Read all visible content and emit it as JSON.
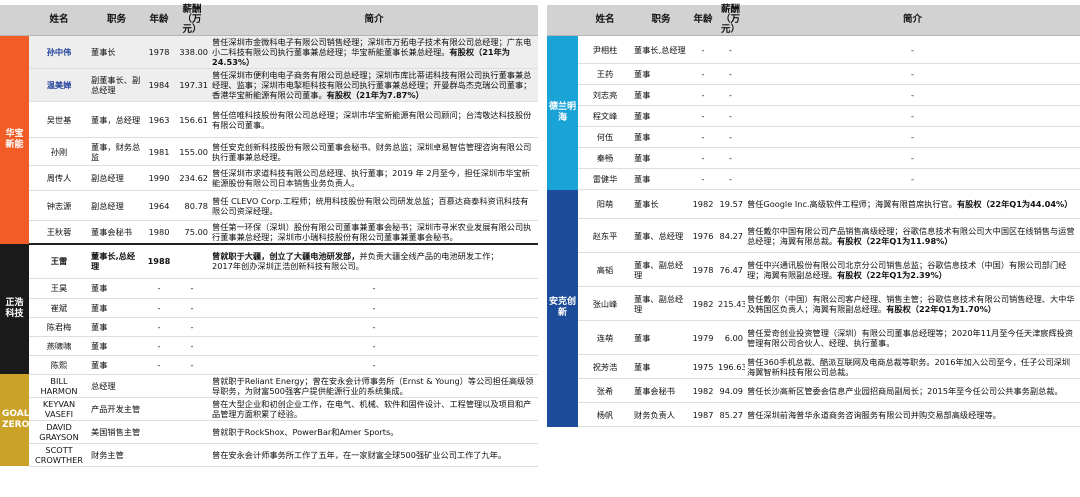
{
  "headers": {
    "company": "",
    "name": "姓名",
    "position": "职务",
    "age": "年龄",
    "salary": "薪酬（万元）",
    "bio": "简介"
  },
  "left_groups": [
    {
      "company": "华宝新能",
      "color": "#f25c27",
      "rows": [
        {
          "name": "孙中伟",
          "position": "董事长",
          "age": "1978",
          "salary": "338.00",
          "bio": "曾任深圳市金微科电子有限公司销售经理；深圳市万拓电子技术有限公司总经理；广东电小二科技有限公司执行董事兼总经理；华宝新能董事长兼总经理。",
          "bio_bold": "有股权（21年为24.53%）",
          "highlight": true
        },
        {
          "name": "温美婵",
          "position": "副董事长、副总经理",
          "age": "1984",
          "salary": "197.31",
          "bio": "曾任深圳市便利电电子商务有限公司总经理；深圳市库比蒂诺科技有限公司执行董事兼总经理、监事；深圳市电掣柜科技有限公司执行董事兼总经理；开曼群岛杰克瑞公司董事；香港华宝新能源有限公司董事。",
          "bio_bold": "有股权（21年为7.87%）",
          "highlight": true
        },
        {
          "name": "吴世基",
          "position": "董事，总经理",
          "age": "1963",
          "salary": "156.61",
          "bio": "曾任倍唯科技股份有限公司总经理；深圳市华宝新能源有限公司顾问；台湾敬达科技股份有限公司董事。",
          "bio_bold": "",
          "highlight": false
        },
        {
          "name": "孙刚",
          "position": "董事，财务总监",
          "age": "1981",
          "salary": "155.00",
          "bio": "曾任安克创新科技股份有限公司董事会秘书、财务总监；深圳卓易智信管理咨询有限公司执行董事兼总经理。",
          "bio_bold": "",
          "highlight": false
        },
        {
          "name": "周传人",
          "position": "副总经理",
          "age": "1990",
          "salary": "234.62",
          "bio": "曾任深圳市求道科技有限公司总经理、执行董事；2019 年 2月至今，担任深圳市华宝新能源股份有限公司日本销售业务负责人。",
          "bio_bold": "",
          "highlight": false
        },
        {
          "name": "钟志源",
          "position": "副总经理",
          "age": "1964",
          "salary": "80.78",
          "bio": "曾任 CLEVO Corp.工程师；统用科技股份有限公司研发总监；百慕达商泰科资讯科技有限公司资深经理。",
          "bio_bold": "",
          "highlight": false
        },
        {
          "name": "王秋蓉",
          "position": "董事会秘书",
          "age": "1980",
          "salary": "75.00",
          "bio": "曾任第一环保（深圳）股份有限公司董事兼董事会秘书；深圳市寻米农业发展有限公司执行董事兼总经理；深圳市小瑞科技股份有限公司董事兼董事会秘书。",
          "bio_bold": "",
          "highlight": false
        }
      ]
    },
    {
      "company": "正浩科技",
      "color": "#1a1a1a",
      "rows": [
        {
          "name": "王雷",
          "position": "董事长,总经理",
          "age": "1988",
          "salary": "",
          "bio_bold": "曾就职于大疆，创立了大疆电池研发部，",
          "bio": "并负责大疆全线产品的电池研发工作；\n2017年创办深圳正浩创新科技有限公司。",
          "highlight": false,
          "bold_name": true
        },
        {
          "name": "王昊",
          "position": "董事",
          "age": "-",
          "salary": "-",
          "bio": "-",
          "bio_bold": "",
          "dash": true
        },
        {
          "name": "崔斌",
          "position": "董事",
          "age": "-",
          "salary": "-",
          "bio": "-",
          "bio_bold": "",
          "dash": true
        },
        {
          "name": "陈君梅",
          "position": "董事",
          "age": "-",
          "salary": "-",
          "bio": "-",
          "bio_bold": "",
          "dash": true
        },
        {
          "name": "燕啸啸",
          "position": "董事",
          "age": "-",
          "salary": "-",
          "bio": "-",
          "bio_bold": "",
          "dash": true
        },
        {
          "name": "陈熙",
          "position": "董事",
          "age": "-",
          "salary": "-",
          "bio": "-",
          "bio_bold": "",
          "dash": true
        }
      ]
    },
    {
      "company": "GOAL ZERO",
      "color": "#c9a227",
      "rows": [
        {
          "name": "BILL HARMON",
          "position": "总经理",
          "age": "",
          "salary": "",
          "bio": "曾就职于Reliant Energy；曾在安永会计师事务所（Ernst & Young）等公司担任高级领导职务，为财富500强客户提供能源行业的系统集成。",
          "bio_bold": ""
        },
        {
          "name": "KEYVAN VASEFI",
          "position": "产品开发主管",
          "age": "",
          "salary": "",
          "bio": "曾在大型企业和初创企业工作，在电气、机械、软件和固件设计、工程管理以及项目和产品管理方面积累了经验。",
          "bio_bold": ""
        },
        {
          "name": "DAVID GRAYSON",
          "position": "美国销售主管",
          "age": "",
          "salary": "",
          "bio": "曾就职于RockShox、PowerBar和Amer Sports。",
          "bio_bold": ""
        },
        {
          "name": "SCOTT CROWTHER",
          "position": "财务主管",
          "age": "",
          "salary": "",
          "bio": "曾在安永会计师事务所工作了五年，在一家财富全球500强矿业公司工作了九年。",
          "bio_bold": ""
        }
      ]
    }
  ],
  "right_groups": [
    {
      "company": "德兰明海",
      "color": "#1aa3d6",
      "rows": [
        {
          "name": "尹相柱",
          "position": "董事长,总经理",
          "age": "-",
          "salary": "-",
          "bio": "-",
          "bio_bold": "",
          "dash": true
        },
        {
          "name": "王药",
          "position": "董事",
          "age": "-",
          "salary": "-",
          "bio": "-",
          "bio_bold": "",
          "dash": true
        },
        {
          "name": "刘志亮",
          "position": "董事",
          "age": "-",
          "salary": "-",
          "bio": "-",
          "bio_bold": "",
          "dash": true
        },
        {
          "name": "程文峰",
          "position": "董事",
          "age": "-",
          "salary": "-",
          "bio": "-",
          "bio_bold": "",
          "dash": true
        },
        {
          "name": "何伍",
          "position": "董事",
          "age": "-",
          "salary": "-",
          "bio": "-",
          "bio_bold": "",
          "dash": true
        },
        {
          "name": "秦畅",
          "position": "董事",
          "age": "-",
          "salary": "-",
          "bio": "-",
          "bio_bold": "",
          "dash": true
        },
        {
          "name": "雷健华",
          "position": "董事",
          "age": "-",
          "salary": "-",
          "bio": "-",
          "bio_bold": "",
          "dash": true
        }
      ]
    },
    {
      "company": "安克创新",
      "color": "#1d4d9a",
      "rows": [
        {
          "name": "阳萌",
          "position": "董事长",
          "age": "1982",
          "salary": "19.57",
          "bio": "曾任Google Inc.高级软件工程师；海翼有限首席执行官。",
          "bio_bold": "有股权（22年Q1为44.04%）"
        },
        {
          "name": "赵东平",
          "position": "董事、总经理",
          "age": "1976",
          "salary": "84.27",
          "bio": "曾任戴尔中国有限公司产品销售高级经理；谷歌信息技术有限公司大中国区在线销售与运营总经理；海翼有限总裁。",
          "bio_bold": "有股权（22年Q1为11.98%）"
        },
        {
          "name": "高韬",
          "position": "董事、副总经理",
          "age": "1978",
          "salary": "76.47",
          "bio": "曾任中兴通讯股份有限公司北京分公司销售总监；谷歌信息技术（中国）有限公司部门经理；海翼有限副总经理。",
          "bio_bold": "有股权（22年Q1为2.39%）"
        },
        {
          "name": "张山峰",
          "position": "董事、副总经理",
          "age": "1982",
          "salary": "215.43",
          "bio": "曾任戴尔（中国）有限公司客户经理、销售主管；谷歌信息技术有限公司销售经理、大中华及韩国区负责人；海翼有限副总经理。",
          "bio_bold": "有股权（22年Q1为1.70%）"
        },
        {
          "name": "连萌",
          "position": "董事",
          "age": "1979",
          "salary": "6.00",
          "bio": "曾任爱奇创业投资管理（深圳）有限公司董事总经理等；2020年11月至今任天津宸辉投资管理有限公司合伙人、经理、执行董事。",
          "bio_bold": ""
        },
        {
          "name": "祝芳浩",
          "position": "董事",
          "age": "1975",
          "salary": "196.63",
          "bio": "曾任360手机总裁、酷派互联网及电商总裁等职务。2016年加入公司至今，任子公司深圳海翼智新科技有限公司总裁。",
          "bio_bold": ""
        },
        {
          "name": "张希",
          "position": "董事会秘书",
          "age": "1982",
          "salary": "94.09",
          "bio": "曾任长沙高新区管委会信息产业园招商局副局长；2015年至今任公司公共事务副总裁。",
          "bio_bold": ""
        },
        {
          "name": "杨帆",
          "position": "财务负责人",
          "age": "1987",
          "salary": "85.27",
          "bio": "曾任深圳前海普华永道商务咨询服务有限公司并购交易部高级经理等。",
          "bio_bold": ""
        }
      ]
    }
  ]
}
